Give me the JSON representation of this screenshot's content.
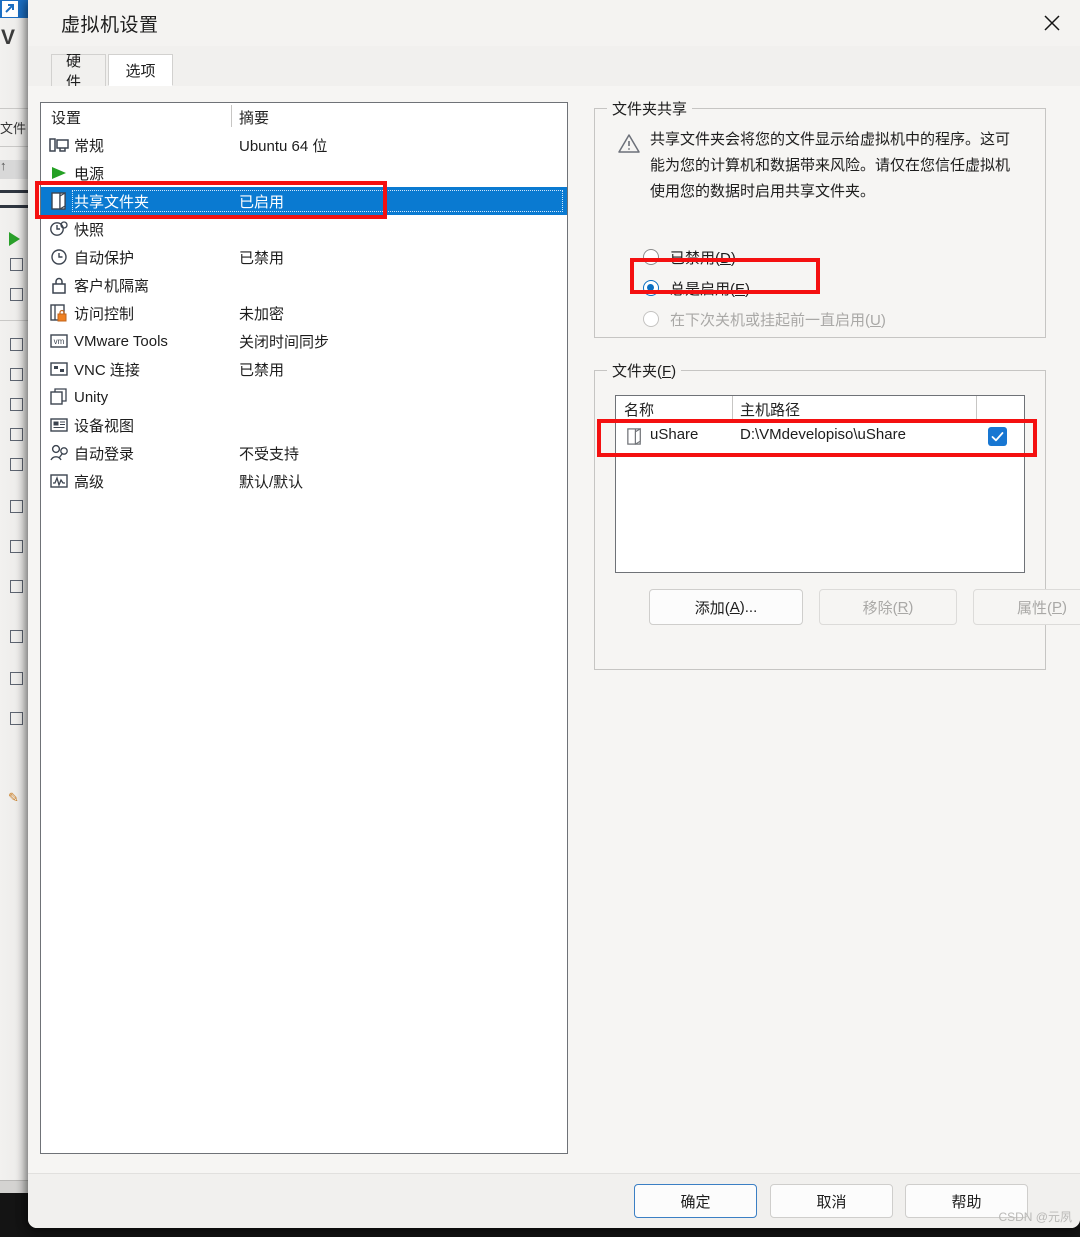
{
  "window": {
    "title": "虚拟机设置",
    "close_icon": "close-icon"
  },
  "tabs": [
    {
      "label": "硬件",
      "active": false
    },
    {
      "label": "选项",
      "active": true
    }
  ],
  "settings_list": {
    "columns": [
      "设置",
      "摘要"
    ],
    "rows": [
      {
        "icon": "monitor-icon",
        "label": "常规",
        "summary": "Ubuntu 64 位",
        "selected": false
      },
      {
        "icon": "play-icon",
        "label": "电源",
        "summary": "",
        "selected": false
      },
      {
        "icon": "folder-icon",
        "label": "共享文件夹",
        "summary": "已启用",
        "selected": true
      },
      {
        "icon": "snapshot-icon",
        "label": "快照",
        "summary": "",
        "selected": false
      },
      {
        "icon": "clock-icon",
        "label": "自动保护",
        "summary": "已禁用",
        "selected": false
      },
      {
        "icon": "lock-icon",
        "label": "客户机隔离",
        "summary": "",
        "selected": false
      },
      {
        "icon": "access-icon",
        "label": "访问控制",
        "summary": "未加密",
        "selected": false
      },
      {
        "icon": "vmtools-icon",
        "label": "VMware Tools",
        "summary": "关闭时间同步",
        "selected": false
      },
      {
        "icon": "vnc-icon",
        "label": "VNC 连接",
        "summary": "已禁用",
        "selected": false
      },
      {
        "icon": "unity-icon",
        "label": "Unity",
        "summary": "",
        "selected": false
      },
      {
        "icon": "deviceview-icon",
        "label": "设备视图",
        "summary": "",
        "selected": false
      },
      {
        "icon": "autologin-icon",
        "label": "自动登录",
        "summary": "不受支持",
        "selected": false
      },
      {
        "icon": "advanced-icon",
        "label": "高级",
        "summary": "默认/默认",
        "selected": false
      }
    ]
  },
  "folder_sharing": {
    "legend": "文件夹共享",
    "warning_icon": "warning-triangle-icon",
    "warning_text": "共享文件夹会将您的文件显示给虚拟机中的程序。这可能为您的计算机和数据带来风险。请仅在您信任虚拟机使用您的数据时启用共享文件夹。",
    "options": [
      {
        "label_prefix": "已禁用(",
        "accel": "D",
        "label_suffix": ")",
        "checked": false,
        "disabled": false
      },
      {
        "label_prefix": "总是启用(",
        "accel": "E",
        "label_suffix": ")",
        "checked": true,
        "disabled": false
      },
      {
        "label_prefix": "在下次关机或挂起前一直启用(",
        "accel": "U",
        "label_suffix": ")",
        "checked": false,
        "disabled": true
      }
    ]
  },
  "folders": {
    "legend_prefix": "文件夹(",
    "legend_accel": "F",
    "legend_suffix": ")",
    "columns": [
      "名称",
      "主机路径"
    ],
    "rows": [
      {
        "icon": "folder-icon",
        "name": "uShare",
        "host_path": "D:\\VMdevelopiso\\uShare",
        "enabled": true
      }
    ],
    "buttons": [
      {
        "prefix": "添加(",
        "accel": "A",
        "suffix": ")...",
        "disabled": false
      },
      {
        "prefix": "移除(",
        "accel": "R",
        "suffix": ")",
        "disabled": true
      },
      {
        "prefix": "属性(",
        "accel": "P",
        "suffix": ")",
        "disabled": true
      }
    ]
  },
  "footer": {
    "buttons": [
      {
        "label": "确定",
        "default": true
      },
      {
        "label": "取消",
        "default": false
      },
      {
        "label": "帮助",
        "default": false
      }
    ],
    "watermark": "CSDN @元夙"
  },
  "colors": {
    "selection_blue": "#0a7ad1",
    "accent_blue": "#0a6fc2",
    "annotation_red": "#f41010",
    "checkbox_blue": "#1877d2",
    "dialog_bg": "#f6f5f3"
  }
}
